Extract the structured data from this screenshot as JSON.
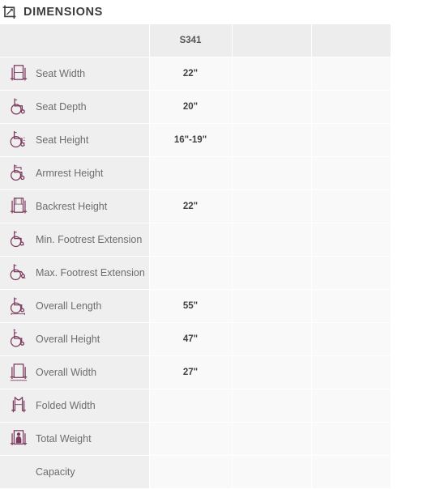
{
  "section": {
    "title": "DIMENSIONS",
    "icon": "crop-icon",
    "icon_color": "#3d3d3d"
  },
  "theme": {
    "icon_color": "#7b3a5e",
    "label_bg": "#efefef",
    "value_bg": "#f9f9f9",
    "header_bg": "#ededed",
    "label_text": "#6d6d6d",
    "value_text": "#404040",
    "title_text": "#3d3d3d"
  },
  "table": {
    "columns": [
      {
        "key": "label",
        "header": ""
      },
      {
        "key": "v1",
        "header": "S341"
      },
      {
        "key": "v2",
        "header": ""
      },
      {
        "key": "v3",
        "header": ""
      }
    ],
    "rows": [
      {
        "icon": "wheelchair-front-seat-width-icon",
        "label": "Seat Width",
        "v1": "22\"",
        "v2": "",
        "v3": ""
      },
      {
        "icon": "wheelchair-side-seat-depth-icon",
        "label": "Seat Depth",
        "v1": "20\"",
        "v2": "",
        "v3": ""
      },
      {
        "icon": "wheelchair-side-seat-height-icon",
        "label": "Seat Height",
        "v1": "16\"-19\"",
        "v2": "",
        "v3": ""
      },
      {
        "icon": "wheelchair-side-armrest-height-icon",
        "label": "Armrest Height",
        "v1": "",
        "v2": "",
        "v3": ""
      },
      {
        "icon": "wheelchair-front-backrest-height-icon",
        "label": "Backrest Height",
        "v1": "22\"",
        "v2": "",
        "v3": ""
      },
      {
        "icon": "wheelchair-side-min-footrest-icon",
        "label": "Min. Footrest Extension",
        "v1": "",
        "v2": "",
        "v3": ""
      },
      {
        "icon": "wheelchair-side-max-footrest-icon",
        "label": "Max. Footrest Extension",
        "v1": "",
        "v2": "",
        "v3": ""
      },
      {
        "icon": "wheelchair-side-overall-length-icon",
        "label": "Overall Length",
        "v1": "55\"",
        "v2": "",
        "v3": ""
      },
      {
        "icon": "wheelchair-side-overall-height-icon",
        "label": "Overall Height",
        "v1": "47\"",
        "v2": "",
        "v3": ""
      },
      {
        "icon": "wheelchair-front-overall-width-icon",
        "label": "Overall Width",
        "v1": "27\"",
        "v2": "",
        "v3": ""
      },
      {
        "icon": "wheelchair-front-folded-width-icon",
        "label": "Folded Width",
        "v1": "",
        "v2": "",
        "v3": ""
      },
      {
        "icon": "wheelchair-front-total-weight-icon",
        "label": "Total Weight",
        "v1": "",
        "v2": "",
        "v3": ""
      },
      {
        "icon": "",
        "label": "Capacity",
        "v1": "",
        "v2": "",
        "v3": ""
      }
    ]
  }
}
